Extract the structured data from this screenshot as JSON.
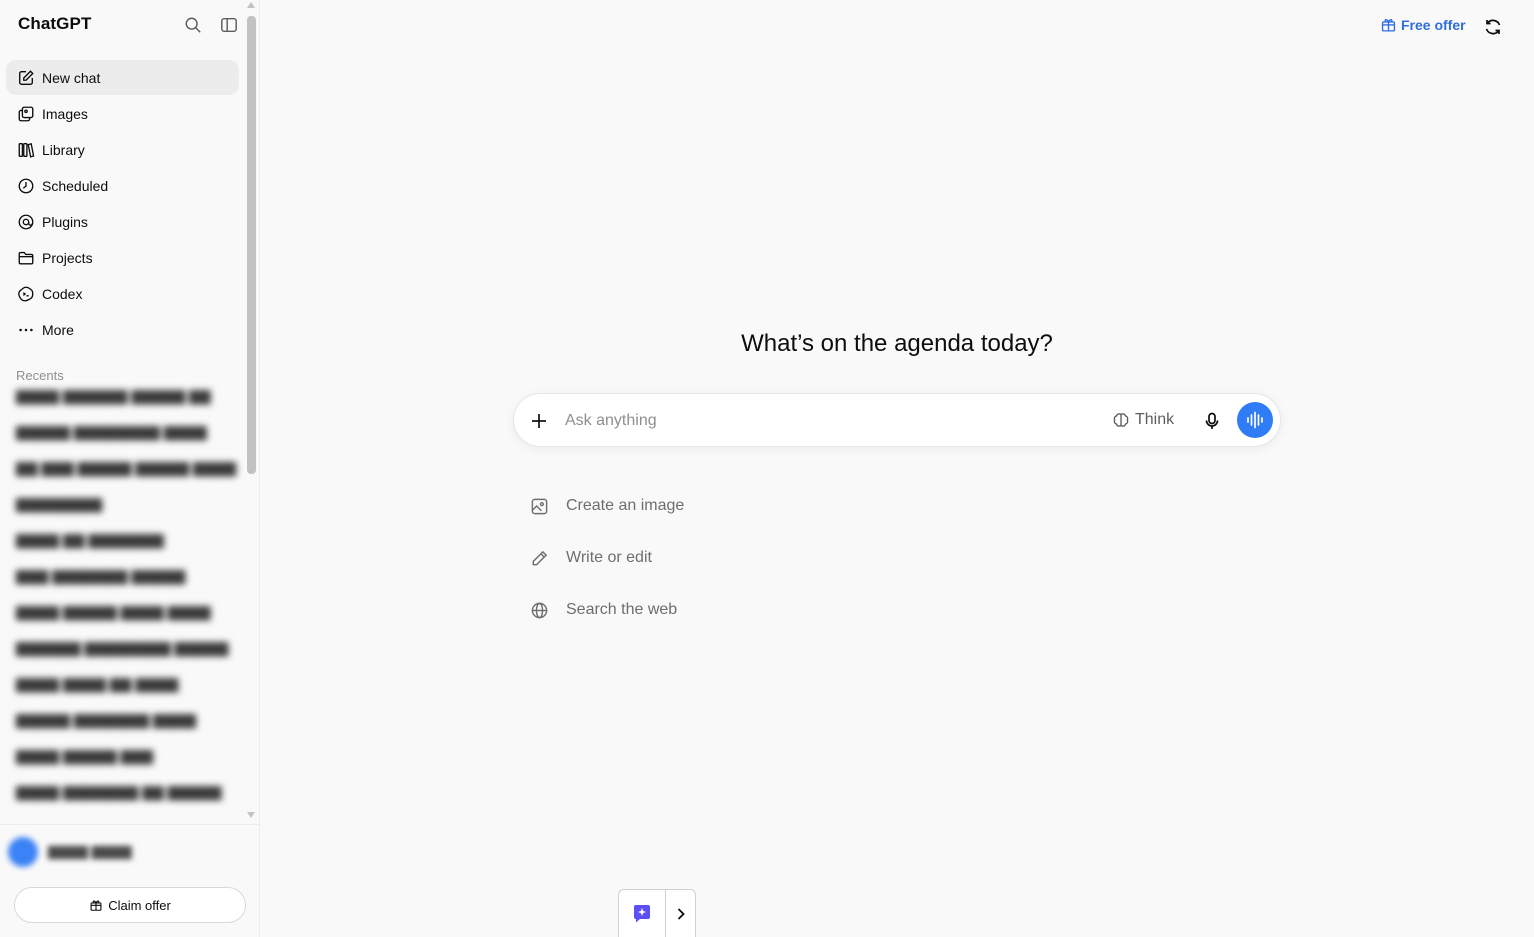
{
  "app": {
    "title": "ChatGPT"
  },
  "sidebar": {
    "items": [
      {
        "label": "New chat",
        "icon": "new-chat-icon",
        "active": true
      },
      {
        "label": "Images",
        "icon": "images-icon"
      },
      {
        "label": "Library",
        "icon": "library-icon"
      },
      {
        "label": "Scheduled",
        "icon": "clock-icon"
      },
      {
        "label": "Plugins",
        "icon": "plugins-icon"
      },
      {
        "label": "Projects",
        "icon": "folder-icon"
      },
      {
        "label": "Codex",
        "icon": "codex-icon"
      },
      {
        "label": "More",
        "icon": "more-icon"
      }
    ],
    "recents_label": "Recents",
    "claim_offer": "Claim offer"
  },
  "topbar": {
    "free_offer": "Free offer"
  },
  "main": {
    "headline": "What’s on the agenda today?",
    "composer": {
      "placeholder": "Ask anything",
      "think_label": "Think"
    },
    "suggestions": [
      {
        "label": "Create an image",
        "icon": "image-icon"
      },
      {
        "label": "Write or edit",
        "icon": "pencil-icon"
      },
      {
        "label": "Search the web",
        "icon": "globe-icon"
      }
    ]
  },
  "colors": {
    "accent": "#2f7cf6",
    "offer_text": "#2f6fdd",
    "background": "#f9f9f9"
  }
}
